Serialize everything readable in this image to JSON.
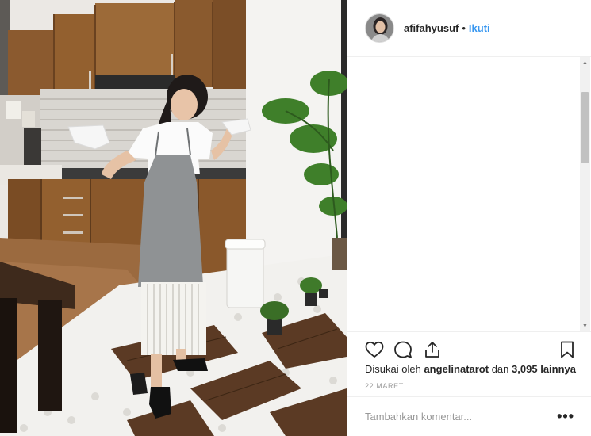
{
  "post": {
    "username": "afifahyusuf",
    "separator": "•",
    "follow_label": "Ikuti",
    "avatar_icon": "profile-photo",
    "image_description_icon": "photo"
  },
  "actions": {
    "like_icon": "heart-icon",
    "comment_icon": "comment-icon",
    "share_icon": "share-icon",
    "save_icon": "bookmark-icon"
  },
  "likes": {
    "prefix": "Disukai oleh",
    "user": "angelinatarot",
    "middle": "dan",
    "count": "3,095",
    "suffix": "lainnya"
  },
  "date": "22 MARET",
  "comment": {
    "placeholder": "Tambahkan komentar...",
    "more_label": "•••"
  },
  "scrollbar": {
    "up_glyph": "▲",
    "down_glyph": "▼"
  },
  "colors": {
    "link": "#3897f0",
    "text": "#262626",
    "muted": "#999999",
    "border": "#efefef"
  }
}
